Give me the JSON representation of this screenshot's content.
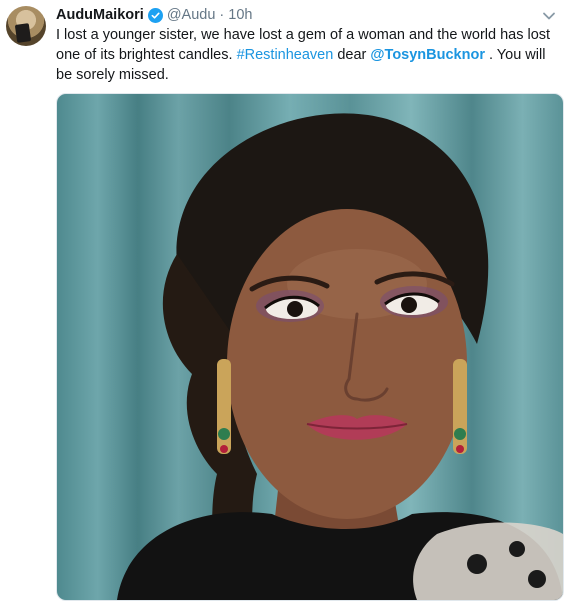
{
  "tweet": {
    "author_name": "AuduMaikori",
    "author_handle": "@Audu",
    "separator": "·",
    "timestamp": "10h",
    "text_part1": "I lost a younger sister, we have lost a gem of a woman and the world has lost one of its brightest candles. ",
    "hashtag": "#Restinheaven",
    "text_part2": " dear ",
    "mention": "@TosynBucknor",
    "text_part3": " . You will be sorely missed."
  },
  "icons": {
    "verified": "verified-badge-icon",
    "menu": "chevron-down-icon"
  },
  "colors": {
    "link": "#1b95e0",
    "verified": "#1da1f2",
    "muted": "#657786"
  }
}
